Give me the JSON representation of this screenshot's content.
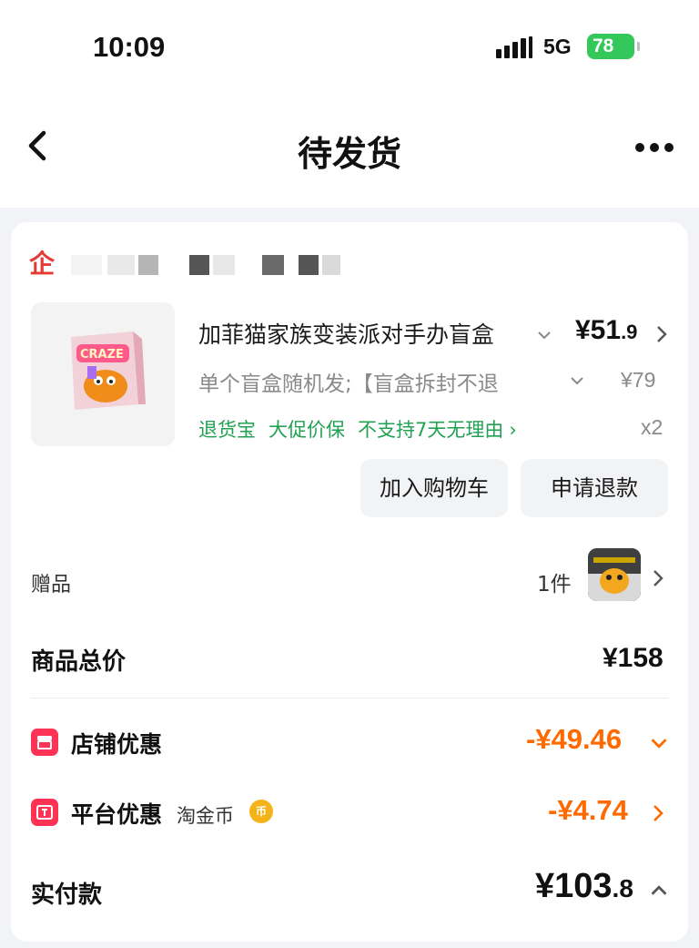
{
  "status_bar": {
    "time": "10:09",
    "network": "5G",
    "battery": "78"
  },
  "nav": {
    "title": "待发货"
  },
  "shop": {
    "logo_glyph": "企"
  },
  "product": {
    "title": "加菲猫家族变装派对手办盲盒",
    "price_main": "¥51",
    "price_decimal": ".9",
    "sku": "单个盲盒随机发;【盲盒拆封不退",
    "original_price": "¥79",
    "tags": [
      "退货宝",
      "大促价保",
      "不支持7天无理由"
    ],
    "tags_arrow": "›",
    "quantity": "x2",
    "thumb_text": "CRAZE"
  },
  "actions": {
    "add_cart": "加入购物车",
    "refund": "申请退款"
  },
  "gift": {
    "label": "赠品",
    "count": "1件"
  },
  "summary": {
    "total_label": "商品总价",
    "total_value": "¥158",
    "shop_discount_label": "店铺优惠",
    "shop_discount_value": "-¥49.46",
    "platform_discount_label": "平台优惠",
    "platform_discount_sub": "淘金币",
    "coin_glyph": "币",
    "platform_discount_value": "-¥4.74",
    "paid_label": "实付款",
    "paid_main": "¥103",
    "paid_decimal": ".8"
  },
  "colors": {
    "accent_orange": "#ff6a00",
    "green_tag": "#22a152",
    "promo_red": "#ff3355",
    "battery_green": "#34c759"
  }
}
